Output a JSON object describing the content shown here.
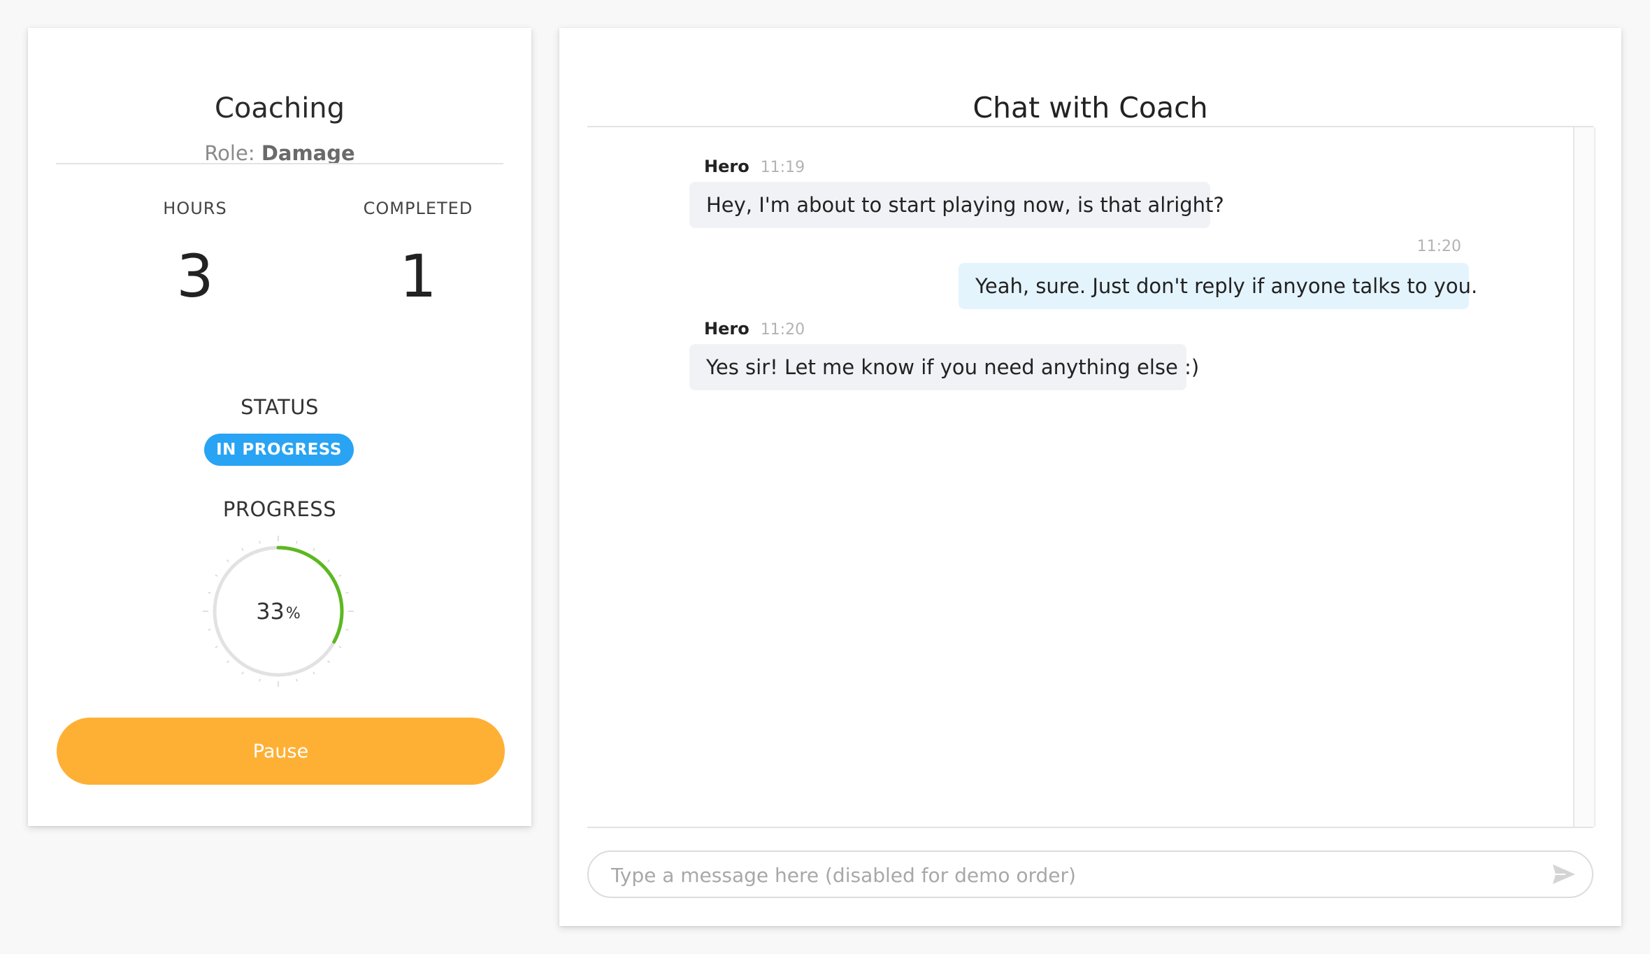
{
  "coaching": {
    "title": "Coaching",
    "role_prefix": "Role:",
    "role_value": "Damage",
    "hours_label": "HOURS",
    "hours_value": "3",
    "completed_label": "COMPLETED",
    "completed_value": "1",
    "status_label": "STATUS",
    "status_value": "IN PROGRESS",
    "progress_label": "PROGRESS",
    "progress_value": "33",
    "progress_unit": "%",
    "progress_fraction": 0.33,
    "pause_label": "Pause"
  },
  "chat": {
    "title": "Chat with Coach",
    "messages": [
      {
        "author": "Hero",
        "time": "11:19",
        "text": "Hey, I'm about to start playing now, is that alright?",
        "direction": "incoming"
      },
      {
        "author": "",
        "time": "11:20",
        "text": "Yeah, sure. Just don't reply if anyone talks to you.",
        "direction": "outgoing"
      },
      {
        "author": "Hero",
        "time": "11:20",
        "text": "Yes sir! Let me know if you need anything else :)",
        "direction": "incoming"
      }
    ],
    "input_placeholder": "Type a message here (disabled for demo order)",
    "send_icon": "send-icon"
  },
  "colors": {
    "status_badge": "#29a3f3",
    "progress_arc": "#5cb81f",
    "pause_button": "#feb035",
    "incoming_bubble": "#f0f2f5",
    "outgoing_bubble": "#e4f4fd"
  }
}
